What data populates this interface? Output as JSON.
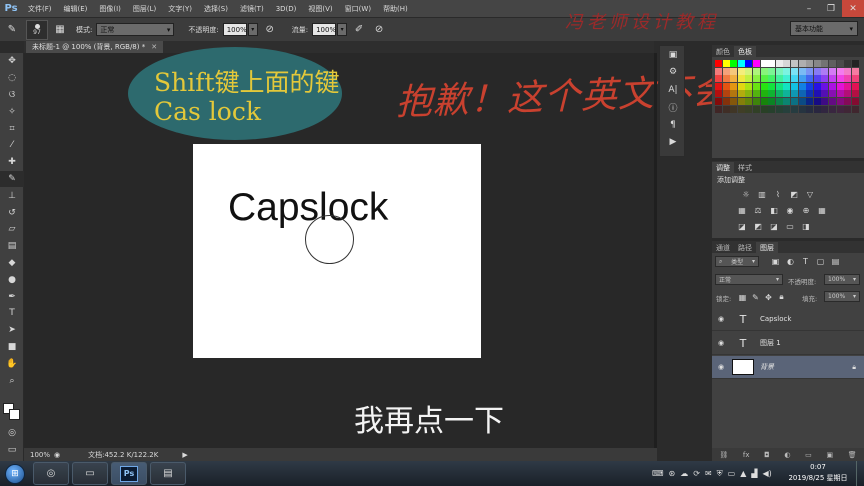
{
  "app": {
    "logo": "Ps",
    "menus": [
      "文件(F)",
      "编辑(E)",
      "图像(I)",
      "图层(L)",
      "文字(Y)",
      "选择(S)",
      "滤镜(T)",
      "3D(D)",
      "视图(V)",
      "窗口(W)",
      "帮助(H)"
    ],
    "window_controls": [
      "minimize-icon",
      "restore-icon",
      "close-icon"
    ]
  },
  "options_bar": {
    "brush_size": "97",
    "mode_label": "模式:",
    "mode_value": "正常",
    "opacity_label": "不透明度:",
    "opacity_value": "100%",
    "flow_label": "流量:",
    "flow_value": "100%",
    "workspace": "基本功能",
    "watermark": "冯老师设计教程"
  },
  "document": {
    "tab_title": "未标题-1 @ 100% (背景, RGB/8) *",
    "canvas_text": "Capslock",
    "bg_color": "#ffffff"
  },
  "overlays": {
    "ellipse_line1": "Shift键上面的键",
    "ellipse_line2": "Cas lock",
    "apology": "抱歉！这个英文不会读",
    "subtitle": "我再点一下",
    "ellipse_color": "#2d6a6e",
    "ellipse_text_color": "#e3c83a",
    "apology_color": "#c9412f"
  },
  "status_bar": {
    "zoom": "100%",
    "doc_info": "文档:452.2 K/122.2K"
  },
  "toolbar": {
    "tools": [
      "move-tool-icon",
      "marquee-tool-icon",
      "lasso-tool-icon",
      "quick-select-icon",
      "crop-tool-icon",
      "eyedropper-icon",
      "healing-brush-icon",
      "brush-tool-icon",
      "clone-stamp-icon",
      "history-brush-icon",
      "eraser-icon",
      "gradient-icon",
      "blur-icon",
      "dodge-icon",
      "pen-tool-icon",
      "type-tool-icon",
      "path-select-icon",
      "shape-tool-icon",
      "hand-tool-icon",
      "zoom-tool-icon"
    ],
    "active_tool": "brush-tool-icon",
    "foreground": "#ffffff",
    "background": "#ffffff"
  },
  "panels": {
    "swatch_tabs": [
      "颜色",
      "色板"
    ],
    "active_swatch_tab": "色板",
    "adjust_tabs": [
      "调整",
      "样式"
    ],
    "adjust_title": "添加调整",
    "layer_tabs": [
      "通道",
      "路径",
      "图层"
    ],
    "active_layer_tab": "图层",
    "kind_label": "类型",
    "blend_mode": "正常",
    "opacity_label": "不透明度:",
    "opacity_value": "100%",
    "lock_label": "锁定:",
    "fill_label": "填充:",
    "fill_value": "100%",
    "layers": [
      {
        "name": "Capslock",
        "type": "text",
        "selected": false
      },
      {
        "name": "图层 1",
        "type": "text",
        "selected": false
      },
      {
        "name": "背景",
        "type": "background",
        "selected": true
      }
    ]
  },
  "taskbar": {
    "apps": [
      "media-player-icon",
      "explorer-icon",
      "photoshop-icon",
      "folder-icon"
    ],
    "active_app": "photoshop-icon",
    "time": "0:07",
    "date": "2019/8/25 星期日"
  }
}
